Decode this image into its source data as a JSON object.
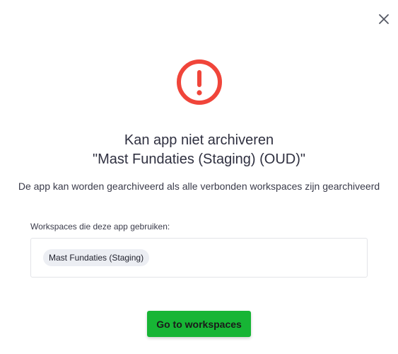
{
  "dialog": {
    "close_icon": "close-icon",
    "alert_icon": "exclamation-circle-icon",
    "alert_color": "#f0453a",
    "title_line1": "Kan app niet archiveren",
    "title_line2": "\"Mast Fundaties (Staging) (OUD)\"",
    "description": "De app kan worden gearchiveerd als alle verbonden workspaces zijn gearchiveerd",
    "workspaces_label": "Workspaces die deze app gebruiken:",
    "workspaces": [
      "Mast Fundaties (Staging)"
    ],
    "primary_button_label": "Go to workspaces",
    "primary_button_color": "#17b535"
  }
}
